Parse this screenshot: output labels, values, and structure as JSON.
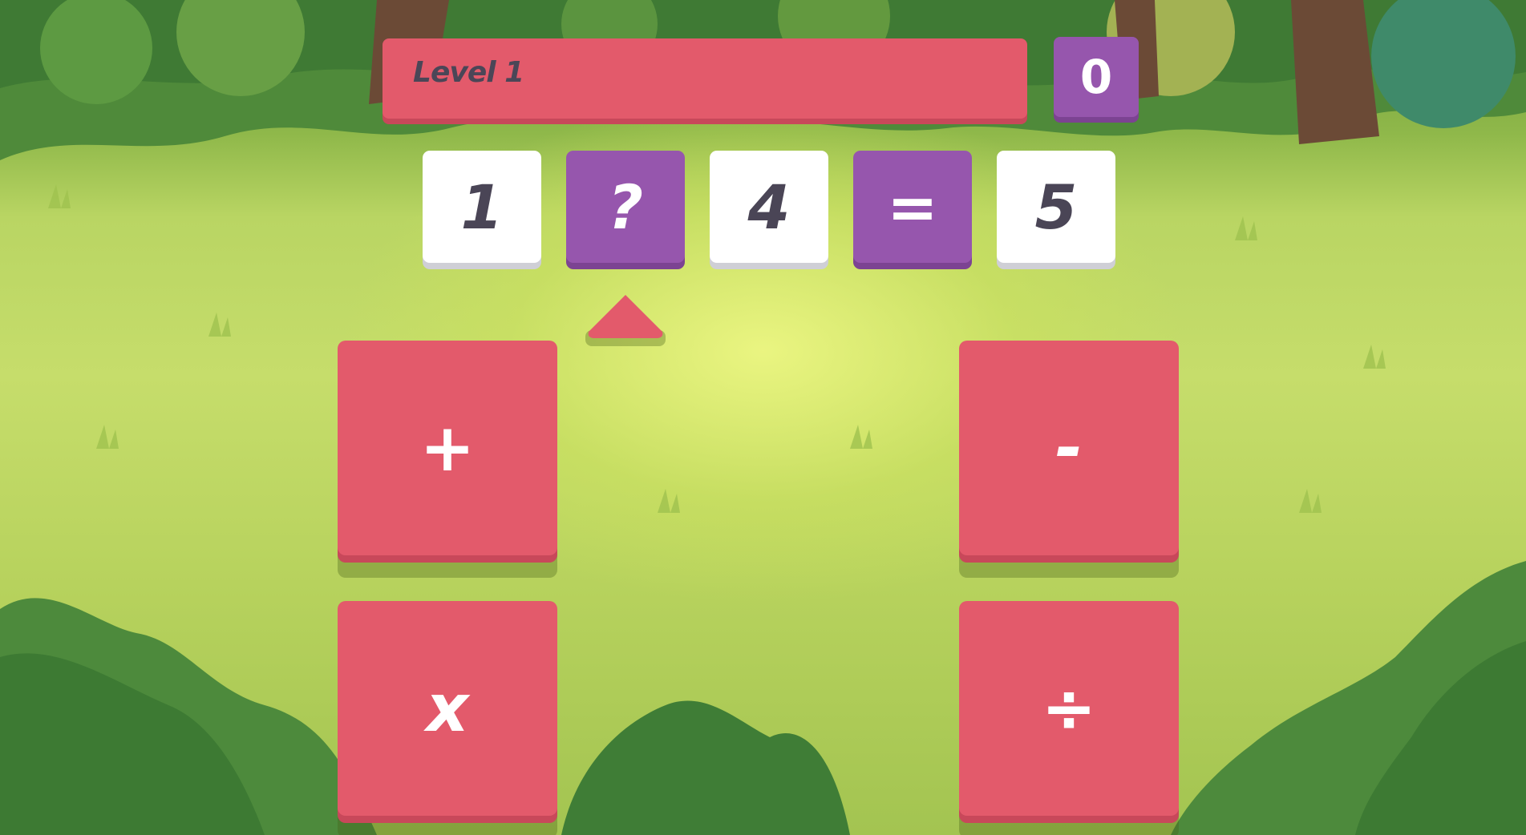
{
  "level": {
    "label": "Level 1"
  },
  "score": {
    "value": "0"
  },
  "equation": {
    "operand_1": "1",
    "operator_slot": "?",
    "operand_2": "4",
    "equals": "=",
    "result": "5"
  },
  "operators": {
    "plus": "+",
    "minus": "-",
    "multiply": "x",
    "divide": "÷"
  },
  "icons": {
    "pointer": "up-triangle-icon"
  },
  "colors": {
    "red": "#e35a6b",
    "purple": "#9656ad",
    "white": "#ffffff",
    "dark_text": "#4a4556"
  }
}
